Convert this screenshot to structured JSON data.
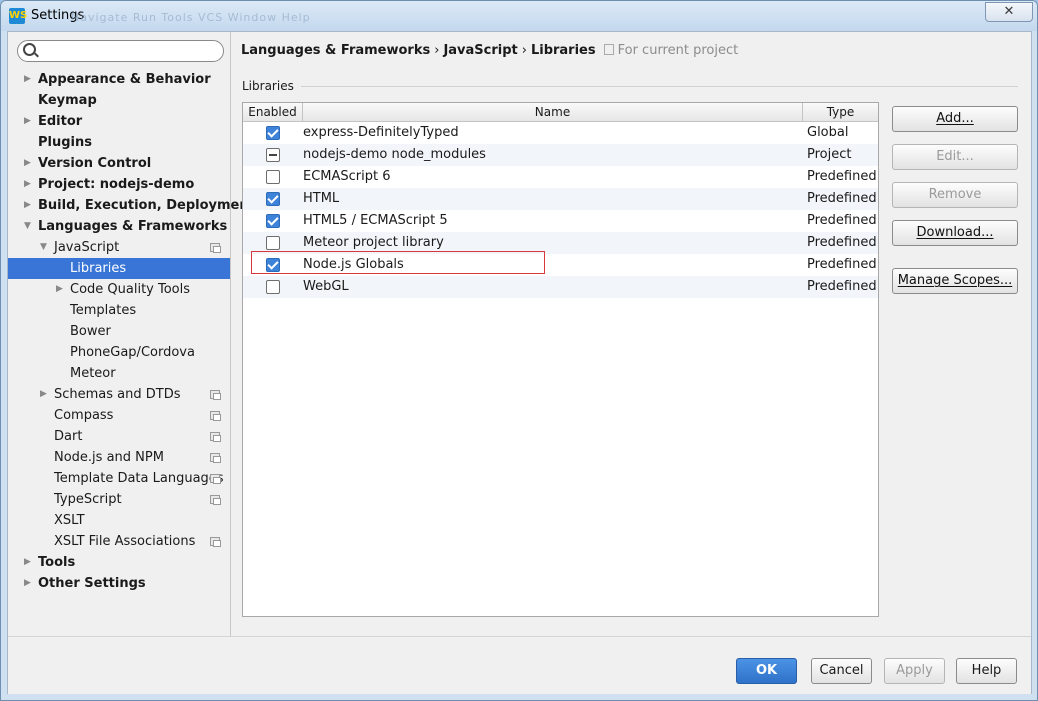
{
  "window": {
    "title": "Settings",
    "logo": "WS",
    "ghost_menu": "Navigate   Run   Tools   VCS   Window   Help",
    "close_glyph": "✕"
  },
  "search": {
    "placeholder": "",
    "value": ""
  },
  "sidebar": {
    "items": [
      {
        "label": "Appearance & Behavior"
      },
      {
        "label": "Keymap"
      },
      {
        "label": "Editor"
      },
      {
        "label": "Plugins"
      },
      {
        "label": "Version Control"
      },
      {
        "label": "Project: nodejs-demo"
      },
      {
        "label": "Build, Execution, Deployment"
      },
      {
        "label": "Languages & Frameworks"
      },
      {
        "label": "JavaScript"
      },
      {
        "label": "Libraries"
      },
      {
        "label": "Code Quality Tools"
      },
      {
        "label": "Templates"
      },
      {
        "label": "Bower"
      },
      {
        "label": "PhoneGap/Cordova"
      },
      {
        "label": "Meteor"
      },
      {
        "label": "Schemas and DTDs"
      },
      {
        "label": "Compass"
      },
      {
        "label": "Dart"
      },
      {
        "label": "Node.js and NPM"
      },
      {
        "label": "Template Data Languages"
      },
      {
        "label": "TypeScript"
      },
      {
        "label": "XSLT"
      },
      {
        "label": "XSLT File Associations"
      },
      {
        "label": "Tools"
      },
      {
        "label": "Other Settings"
      }
    ]
  },
  "breadcrumb": {
    "part1": "Languages & Frameworks",
    "part2": "JavaScript",
    "part3": "Libraries",
    "separator": "›",
    "note": "For current project"
  },
  "libraries": {
    "group_title": "Libraries",
    "columns": {
      "enabled": "Enabled",
      "name": "Name",
      "type": "Type"
    },
    "rows": [
      {
        "name": "express-DefinitelyTyped",
        "type": "Global",
        "state": "checked"
      },
      {
        "name": "nodejs-demo node_modules",
        "type": "Project",
        "state": "mixed"
      },
      {
        "name": "ECMAScript 6",
        "type": "Predefined",
        "state": "unchecked"
      },
      {
        "name": "HTML",
        "type": "Predefined",
        "state": "checked"
      },
      {
        "name": "HTML5 / ECMAScript 5",
        "type": "Predefined",
        "state": "checked"
      },
      {
        "name": "Meteor project library",
        "type": "Predefined",
        "state": "unchecked"
      },
      {
        "name": "Node.js Globals",
        "type": "Predefined",
        "state": "checked"
      },
      {
        "name": "WebGL",
        "type": "Predefined",
        "state": "unchecked"
      }
    ],
    "highlight_color": "#d8383d"
  },
  "actions": {
    "add": "Add...",
    "edit": "Edit...",
    "remove": "Remove",
    "download": "Download...",
    "manage_scopes": "Manage Scopes..."
  },
  "footer": {
    "ok": "OK",
    "cancel": "Cancel",
    "apply": "Apply",
    "help": "Help"
  },
  "colors": {
    "selection": "#3875d7",
    "primary_button": "#3a80d8",
    "checkbox": "#3d83d9"
  }
}
